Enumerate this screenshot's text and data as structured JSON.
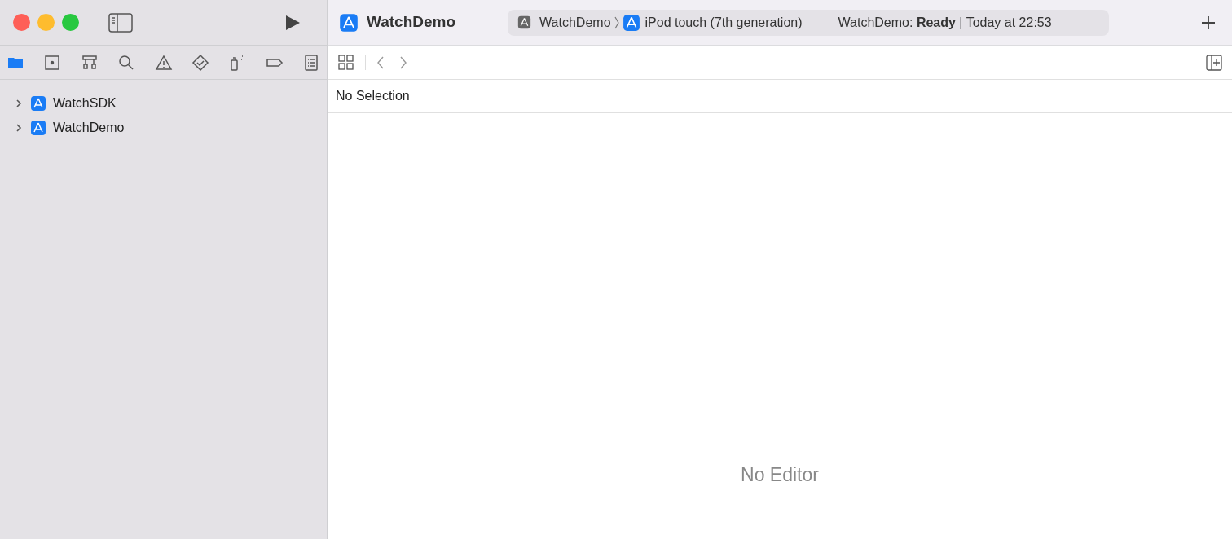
{
  "toolbar": {
    "project_title": "WatchDemo",
    "scheme": "WatchDemo",
    "destination": "iPod touch (7th generation)",
    "status": "WatchDemo: **Ready** | Today at 22:53"
  },
  "navigator_tabs": [
    {
      "kind": "folder",
      "selected": true
    },
    {
      "kind": "source-control",
      "selected": false
    },
    {
      "kind": "hierarchy",
      "selected": false
    },
    {
      "kind": "search",
      "selected": false
    },
    {
      "kind": "warning",
      "selected": false
    },
    {
      "kind": "test",
      "selected": false
    },
    {
      "kind": "debug",
      "selected": false
    },
    {
      "kind": "breakpoint",
      "selected": false
    },
    {
      "kind": "report",
      "selected": false
    }
  ],
  "project_tree": [
    {
      "label": "WatchSDK",
      "expanded": false
    },
    {
      "label": "WatchDemo",
      "expanded": false
    }
  ],
  "editor": {
    "jump_bar": "No Selection",
    "placeholder": "No Editor"
  }
}
